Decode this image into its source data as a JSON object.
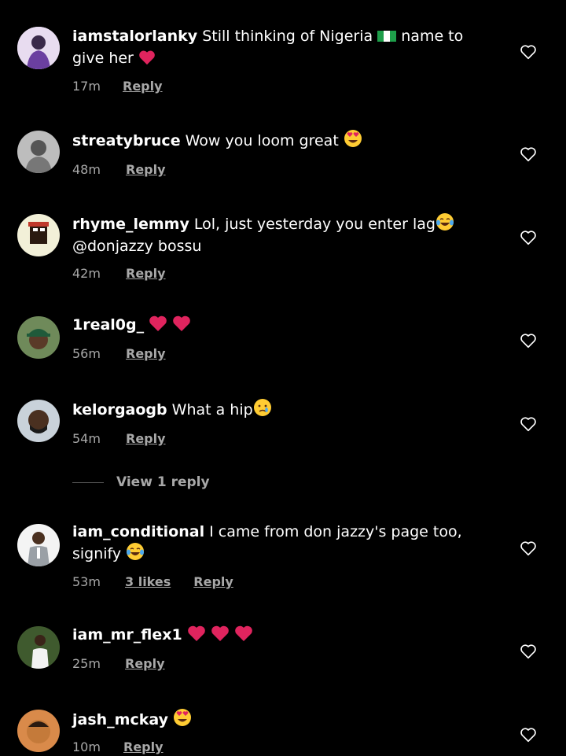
{
  "comments": [
    {
      "username": "iamstalorlanky",
      "text": " Still thinking of Nigeria",
      "text_after_flag": " name to give her",
      "time": "17m",
      "likes": "",
      "reply": "Reply",
      "emoji": "nigeria-flag,red-heart"
    },
    {
      "username": "streatybruce",
      "text": " Wow you loom great",
      "time": "48m",
      "likes": "",
      "reply": "Reply",
      "emoji": "heart-eyes"
    },
    {
      "username": "rhyme_lemmy",
      "text": " Lol, just yesterday you enter lag",
      "text2": "@donjazzy bossu",
      "time": "42m",
      "likes": "",
      "reply": "Reply",
      "emoji": "tears-of-joy"
    },
    {
      "username": "1real0g_",
      "text": "",
      "time": "56m",
      "likes": "",
      "reply": "Reply",
      "emoji": "red-heart,red-heart"
    },
    {
      "username": "kelorgaogb",
      "text": " What a hip",
      "time": "54m",
      "likes": "",
      "reply": "Reply",
      "emoji": "crying-face"
    },
    {
      "username": "iam_conditional",
      "text": " I came from don jazzy's page too,",
      "text2": "signify",
      "time": "53m",
      "likes": "3 likes",
      "reply": "Reply",
      "emoji": "tears-of-joy"
    },
    {
      "username": "iam_mr_flex1",
      "text": "",
      "time": "25m",
      "likes": "",
      "reply": "Reply",
      "emoji": "red-heart,red-heart,red-heart"
    },
    {
      "username": "jash_mckay",
      "text": "",
      "time": "10m",
      "likes": "",
      "reply": "Reply",
      "emoji": "heart-eyes"
    }
  ],
  "view_replies": "View 1 reply",
  "colors": {
    "background": "#000000",
    "secondary_text": "#a8a8a8",
    "heart_red": "#e0245e"
  }
}
